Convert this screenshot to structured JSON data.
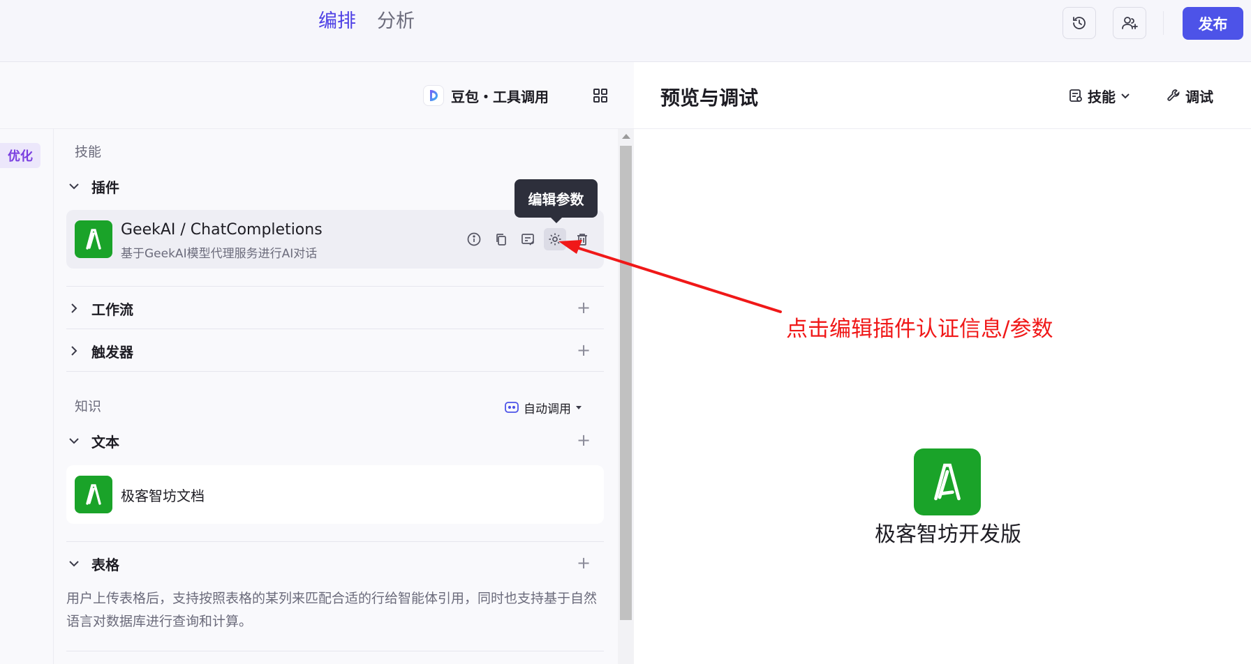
{
  "header": {
    "tabs": [
      {
        "label": "编排",
        "active": true
      },
      {
        "label": "分析",
        "active": false
      }
    ],
    "publish_label": "发布",
    "icons": [
      "history-icon",
      "add-collaborator-icon"
    ]
  },
  "left": {
    "model": {
      "name": "豆包・工具调用"
    },
    "optimize_label": "优化",
    "skills": {
      "label": "技能",
      "plugins": {
        "title": "插件",
        "items": [
          {
            "name": "GeekAI / ChatCompletions",
            "desc": "基于GeekAI模型代理服务进行AI对话"
          }
        ]
      },
      "workflow": {
        "title": "工作流"
      },
      "trigger": {
        "title": "触发器"
      }
    },
    "tooltip": "编辑参数",
    "knowledge": {
      "label": "知识",
      "auto_call": "自动调用",
      "text": {
        "title": "文本",
        "items": [
          {
            "name": "极客智坊文档"
          }
        ]
      },
      "table": {
        "title": "表格",
        "desc": "用户上传表格后，支持按照表格的某列来匹配合适的行给智能体引用，同时也支持基于自然语言对数据库进行查询和计算。"
      }
    }
  },
  "right": {
    "title": "预览与调试",
    "skills_label": "技能",
    "debug_label": "调试",
    "bot_name": "极客智坊开发版"
  },
  "annotation": {
    "text": "点击编辑插件认证信息/参数",
    "color": "#f01818"
  },
  "colors": {
    "accent": "#4d53e8",
    "tab_active": "#4e40e5",
    "app_green": "#1aa329"
  }
}
